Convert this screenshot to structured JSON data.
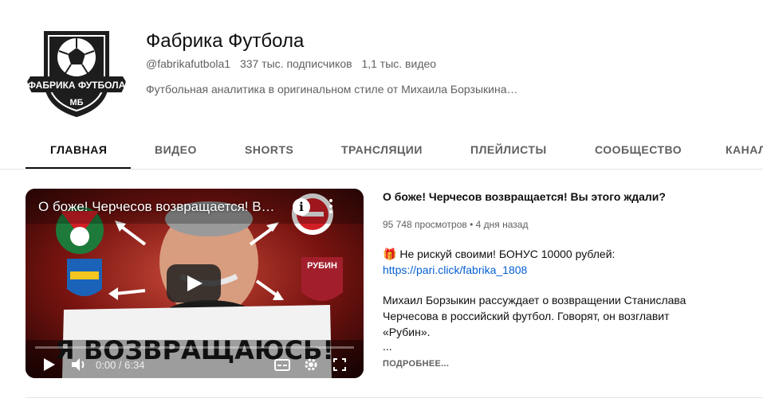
{
  "channel": {
    "name": "Фабрика Футбола",
    "handle": "@fabrikafutbola1",
    "subscribers": "337 тыс. подписчиков",
    "videos": "1,1 тыс. видео",
    "description": "Футбольная аналитика в оригинальном стиле от Михаила Борзыкина…",
    "logo_text": "ФАБРИКА ФУТБОЛА",
    "logo_sub": "МБ"
  },
  "tabs": [
    {
      "label": "ГЛАВНАЯ",
      "active": true
    },
    {
      "label": "ВИДЕО"
    },
    {
      "label": "SHORTS"
    },
    {
      "label": "ТРАНСЛЯЦИИ"
    },
    {
      "label": "ПЛЕЙЛИСТЫ"
    },
    {
      "label": "СООБЩЕСТВО"
    },
    {
      "label": "КАНАЛ"
    }
  ],
  "player": {
    "overlay_title": "О боже! Черчесов возвращается! В…",
    "info_glyph": "i",
    "thumbnail_text": "Я ВОЗВРАЩАЮСЬ!",
    "rubin_text": "РУБИН",
    "time": "0:00 / 6:34",
    "progress": 0
  },
  "video": {
    "title": "О боже! Черчесов возвращается! Вы этого ждали?",
    "views": "95 748 просмотров",
    "dot": "•",
    "age": "4 дня назад",
    "promo_icon": "🎁",
    "promo_text": "Не рискуй своими! БОНУС 10000 рублей:",
    "promo_link": "https://pari.click/fabrika_1808",
    "description_lines": [
      "Михаил Борзыкин рассуждает о возвращении Станислава",
      "Черчесова в российский футбол. Говорят, он возглавит",
      "«Рубин»."
    ],
    "ellipsis": "...",
    "more_label": "ПОДРОБНЕЕ..."
  }
}
